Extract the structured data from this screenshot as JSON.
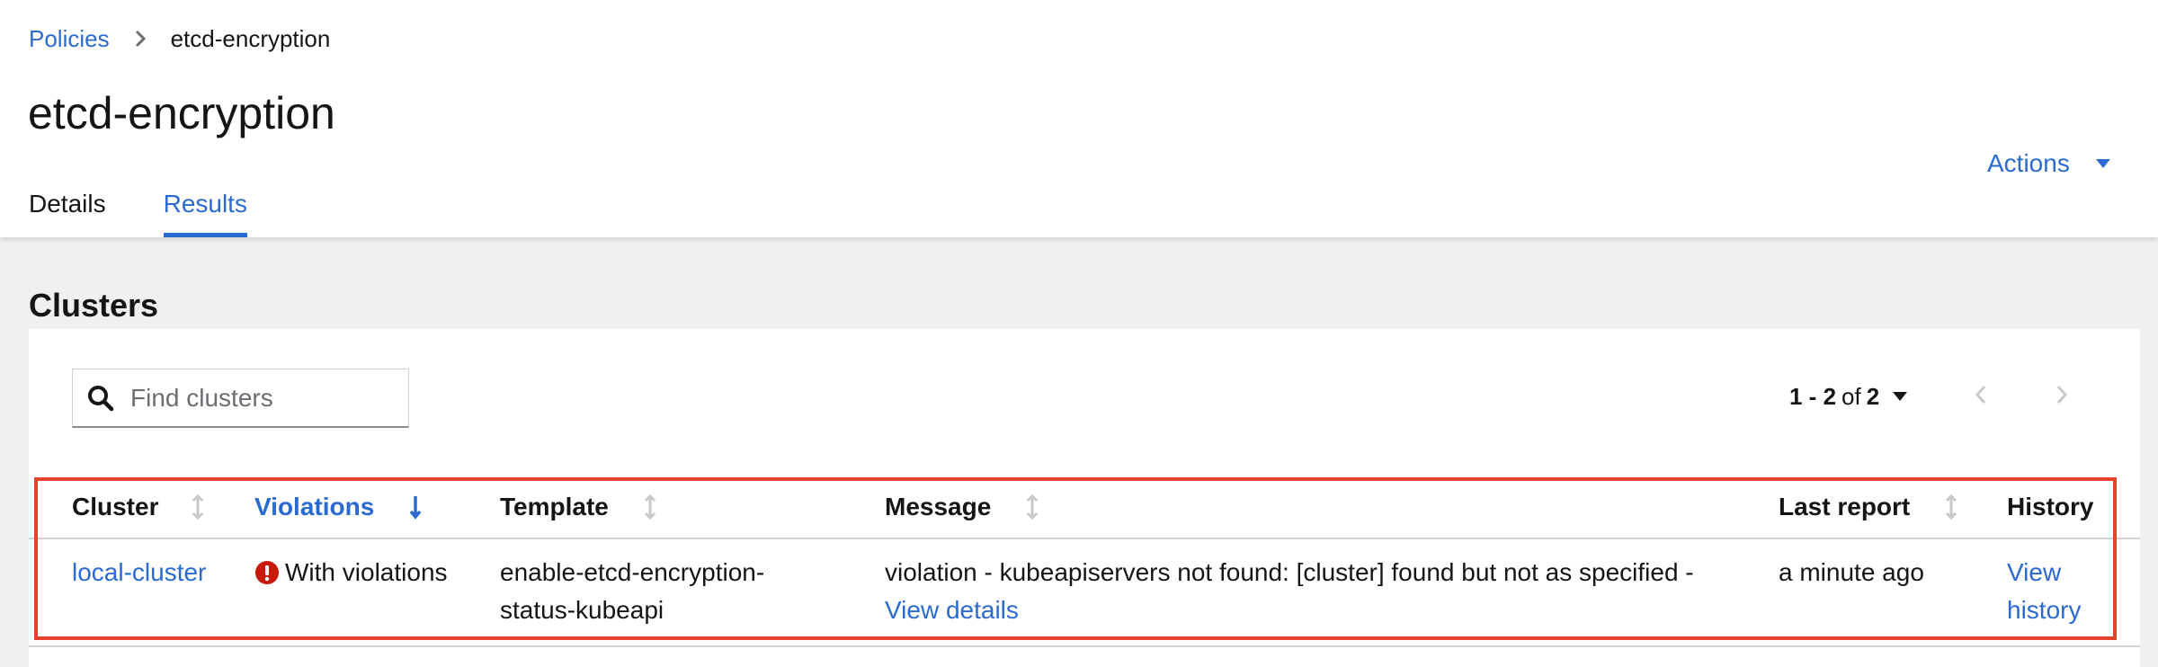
{
  "breadcrumb": {
    "parent": "Policies",
    "current": "etcd-encryption"
  },
  "page": {
    "title": "etcd-encryption"
  },
  "actions": {
    "label": "Actions"
  },
  "tabs": [
    {
      "label": "Details",
      "active": false
    },
    {
      "label": "Results",
      "active": true
    }
  ],
  "section": {
    "title": "Clusters"
  },
  "search": {
    "placeholder": "Find clusters",
    "value": ""
  },
  "pagination": {
    "range": "1 - 2",
    "of_label": "of",
    "total": "2"
  },
  "table": {
    "columns": [
      "Cluster",
      "Violations",
      "Template",
      "Message",
      "Last report",
      "History"
    ],
    "sorted_column": "Violations",
    "rows": [
      {
        "cluster": "local-cluster",
        "violations": "With violations",
        "template_line1": "enable-etcd-encryption-",
        "template_line2": "status-kubeapi",
        "message": "violation - kubeapiservers not found: [cluster] found but not as specified -",
        "message_link": "View details",
        "last_report": "a minute ago",
        "history_line1": "View",
        "history_line2": "history"
      }
    ]
  },
  "colors": {
    "link": "#2b6ad0",
    "danger": "#c9190b",
    "highlight": "#e8432d"
  }
}
